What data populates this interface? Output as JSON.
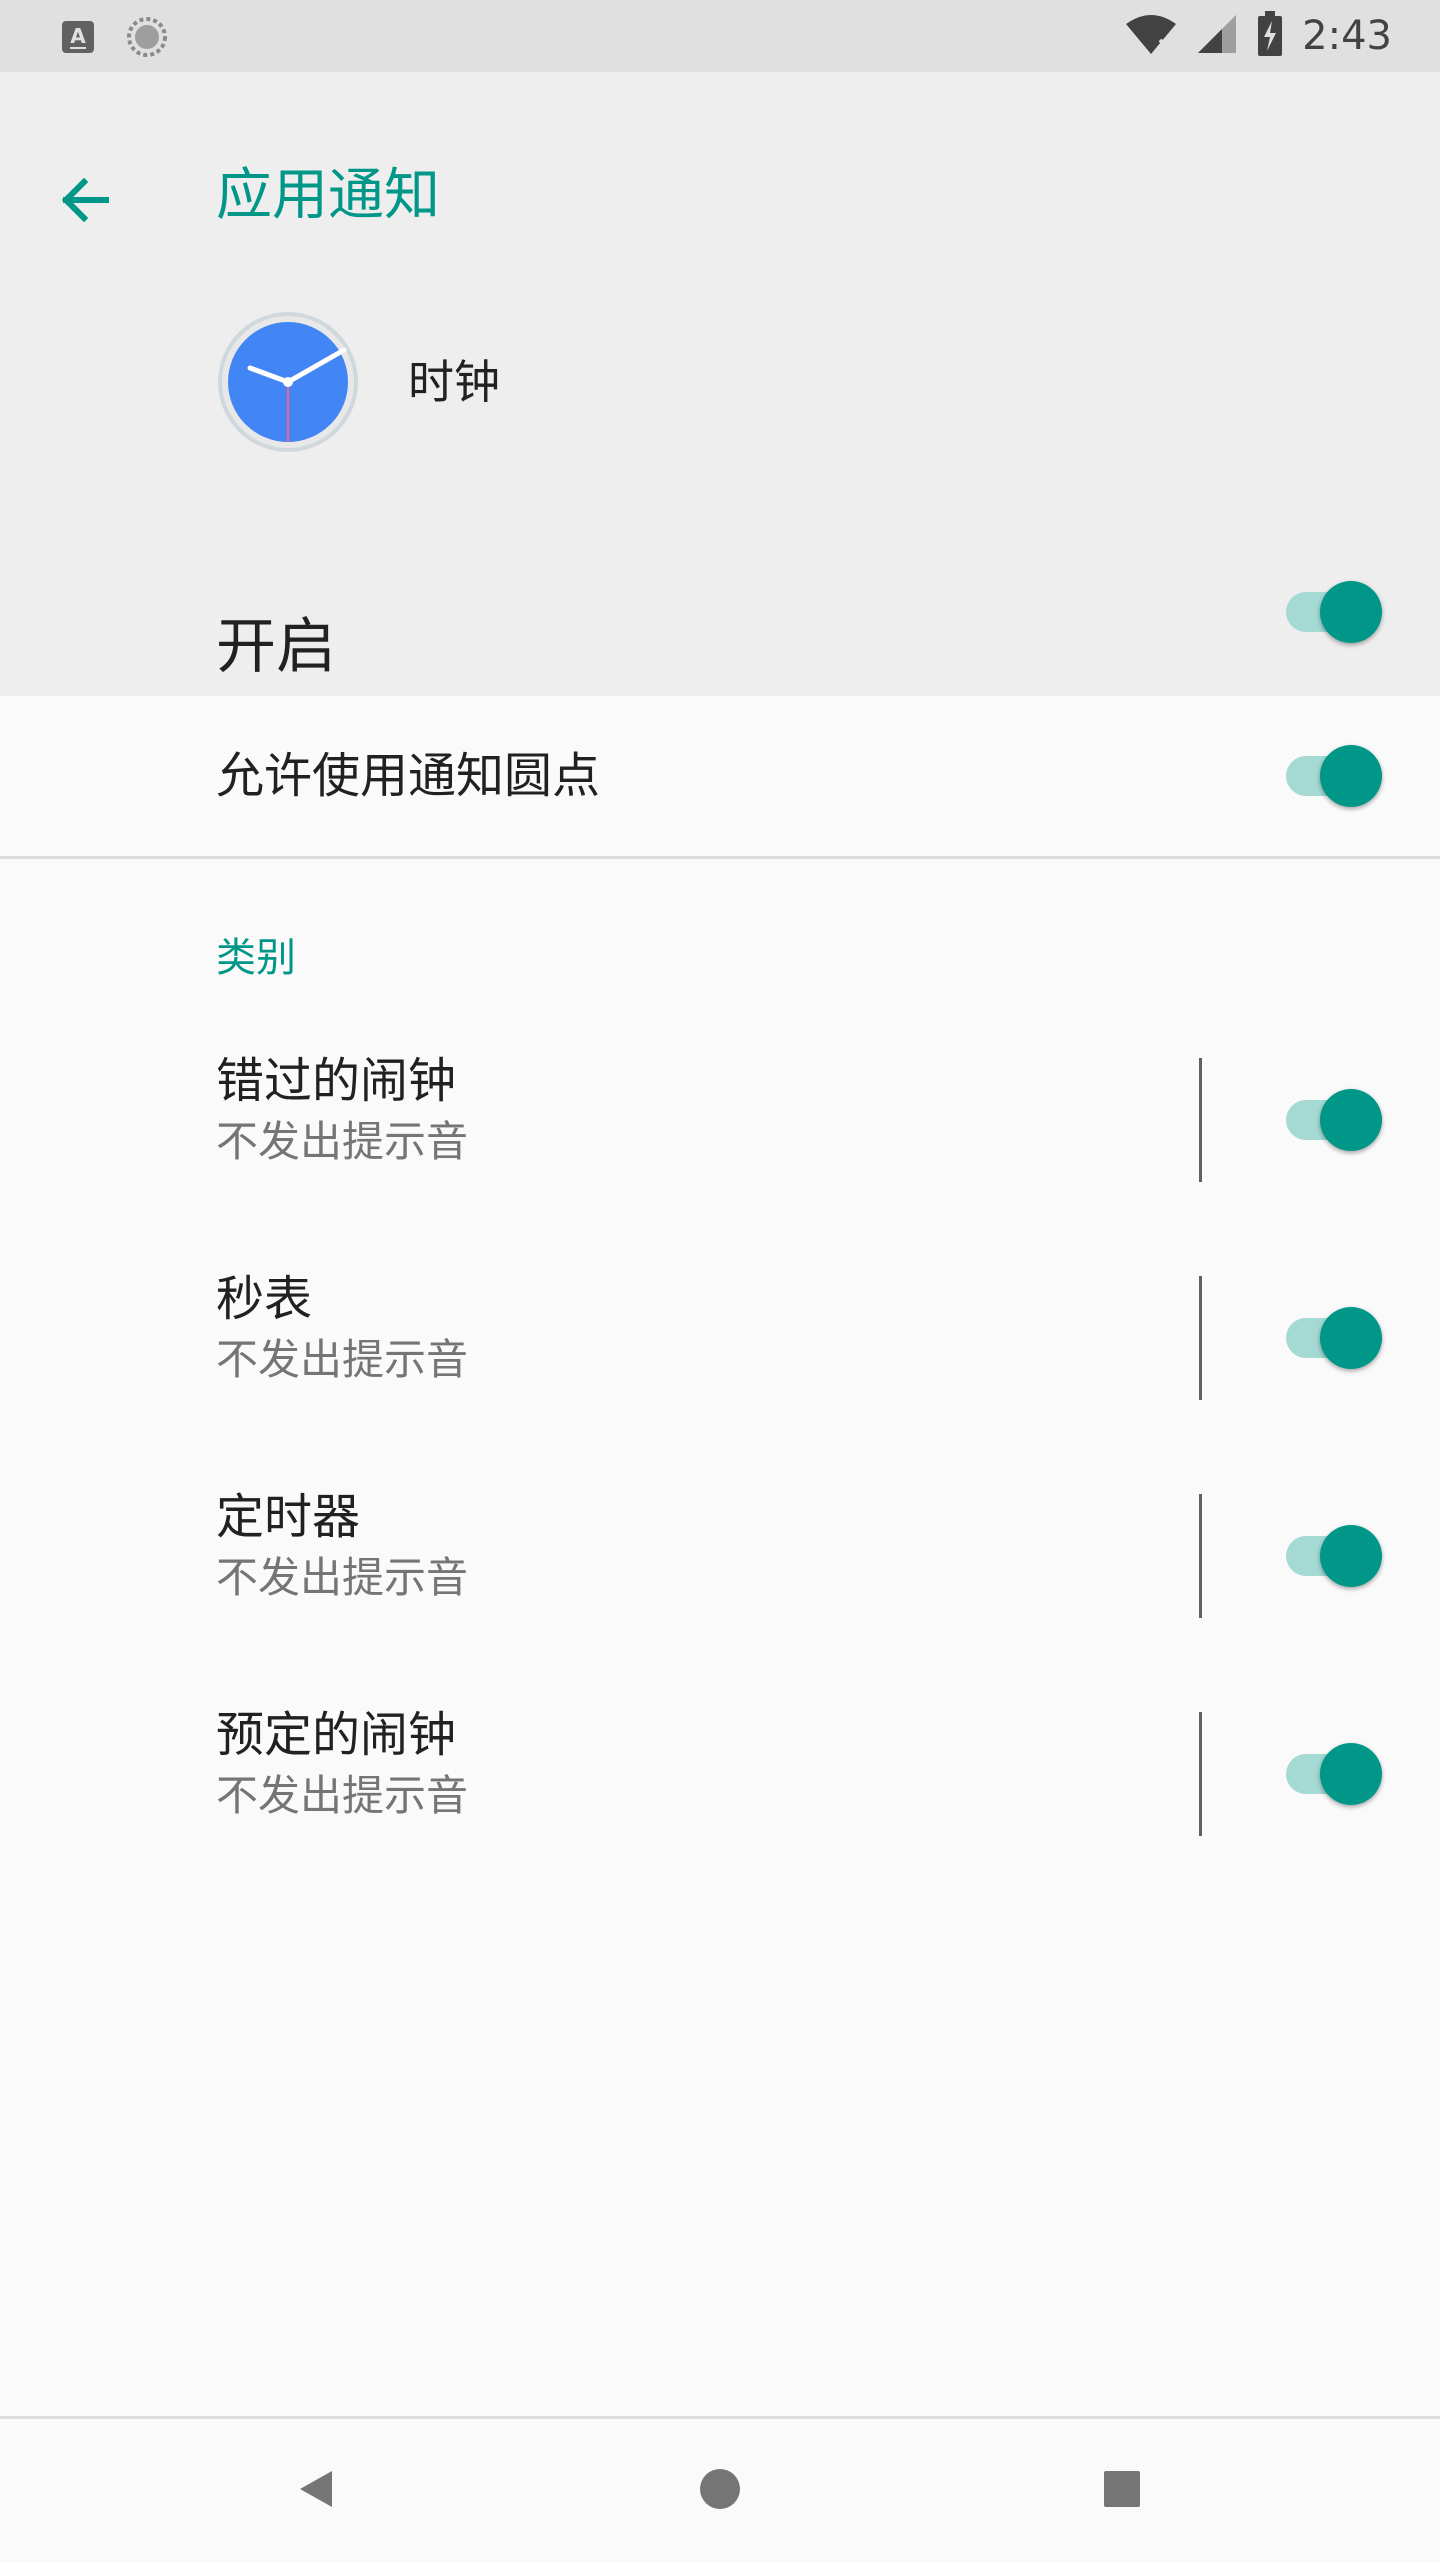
{
  "status_bar": {
    "time": "2:43",
    "left_icons": [
      "keyboard-a-icon",
      "sync-icon"
    ],
    "right_icons": [
      "wifi-off-icon",
      "signal-icon",
      "battery-charging-icon"
    ]
  },
  "header": {
    "title": "应用通知",
    "back_icon": "arrow-back-icon",
    "app_name": "时钟",
    "app_icon": "clock-icon",
    "master_toggle_label": "开启",
    "master_toggle_on": true
  },
  "dots": {
    "label": "允许使用通知圆点",
    "on": true
  },
  "categories": {
    "header": "类别",
    "items": [
      {
        "title": "错过的闹钟",
        "subtitle": "不发出提示音",
        "on": true
      },
      {
        "title": "秒表",
        "subtitle": "不发出提示音",
        "on": true
      },
      {
        "title": "定时器",
        "subtitle": "不发出提示音",
        "on": true
      },
      {
        "title": "预定的闹钟",
        "subtitle": "不发出提示音",
        "on": true
      }
    ]
  },
  "nav_bar": {
    "icons": [
      "back-triangle-icon",
      "home-circle-icon",
      "recents-square-icon"
    ]
  },
  "colors": {
    "accent": "#009688",
    "track_on": "#a4d9d4",
    "header_bg": "#eeeeee",
    "status_bg": "#e0e0e0",
    "page_bg": "#fafafa"
  }
}
